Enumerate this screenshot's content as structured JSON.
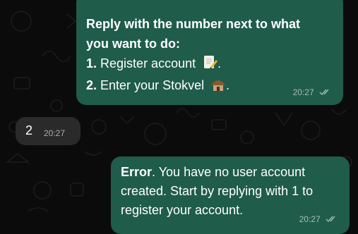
{
  "chat": {
    "background_color": "#0b0b0b",
    "outgoing_bubble_color": "#1f5c49",
    "incoming_bubble_color": "#2a2a2a",
    "messages": [
      {
        "direction": "outgoing",
        "heading_line1": "Reply with the number next to what",
        "heading_line2": "you want to do:",
        "options": [
          {
            "number": "1.",
            "label": "Register account",
            "emoji": "memo-icon"
          },
          {
            "number": "2.",
            "label": "Enter your Stokvel",
            "emoji": "hut-icon",
            "suffix": "."
          }
        ],
        "option1_suffix": ".",
        "time": "20:27",
        "status": "read-ticks-icon"
      },
      {
        "direction": "incoming",
        "text": "2",
        "time": "20:27"
      },
      {
        "direction": "outgoing",
        "bold_word": "Error",
        "line1_rest": ". You have no user account",
        "line2": "created. Start by replying with 1 to",
        "line3": "register your account.",
        "time": "20:27",
        "status": "read-ticks-icon"
      }
    ]
  }
}
